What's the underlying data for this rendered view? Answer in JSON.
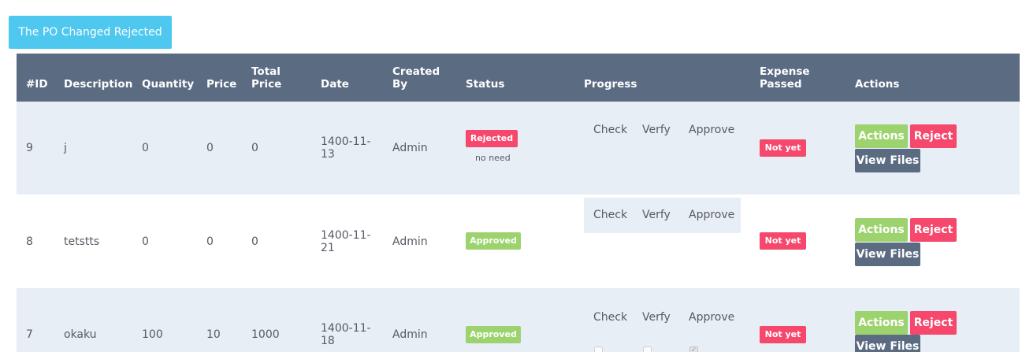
{
  "top_button": "The PO Changed Rejected",
  "headers": {
    "id": "#ID",
    "description": "Description",
    "quantity": "Quantity",
    "price": "Price",
    "total_price_1": "Total",
    "total_price_2": "Price",
    "date": "Date",
    "created_by_1": "Created",
    "created_by_2": "By",
    "status": "Status",
    "progress": "Progress",
    "expense_passed_1": "Expense",
    "expense_passed_2": "Passed",
    "actions": "Actions"
  },
  "progress_labels": {
    "check": "Check",
    "verfy": "Verfy",
    "approve": "Approve"
  },
  "buttons": {
    "actions": "Actions",
    "reject": "Reject",
    "view_files": "View Files"
  },
  "colors": {
    "header_bg": "#5b6b82",
    "row_shade": "#e8eef6",
    "rejected": "#f5486c",
    "approved": "#9dd36e",
    "top_button": "#4fc8ef"
  },
  "rows": [
    {
      "id": "9",
      "description": "j",
      "quantity": "0",
      "price": "0",
      "total_price": "0",
      "date_line1": "1400-11-",
      "date_line2": "13",
      "created_by": "Admin",
      "status": "Rejected",
      "status_note": "no need",
      "expense_passed": "Not yet",
      "progress": {
        "check": false,
        "verfy": false,
        "approve": false
      }
    },
    {
      "id": "8",
      "description": "tetstts",
      "quantity": "0",
      "price": "0",
      "total_price": "0",
      "date_line1": "1400-11-",
      "date_line2": "21",
      "created_by": "Admin",
      "status": "Approved",
      "status_note": "",
      "expense_passed": "Not yet",
      "progress": {
        "check": true,
        "verfy": true,
        "approve": true
      }
    },
    {
      "id": "7",
      "description": "okaku",
      "quantity": "100",
      "price": "10",
      "total_price": "1000",
      "date_line1": "1400-11-",
      "date_line2": "18",
      "created_by": "Admin",
      "status": "Approved",
      "status_note": "",
      "expense_passed": "Not yet",
      "progress": {
        "check": false,
        "verfy": false,
        "approve": true
      }
    }
  ]
}
